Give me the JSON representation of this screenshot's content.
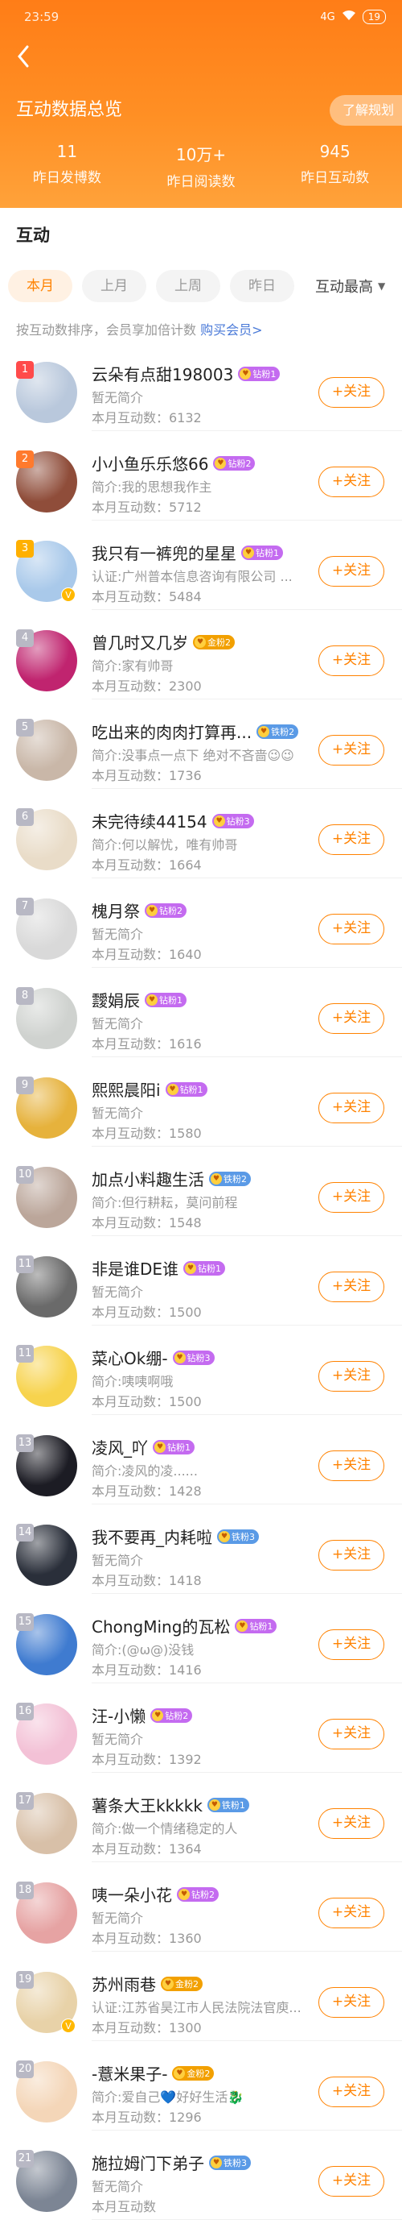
{
  "status_bar": {
    "time": "23:59",
    "signal": "4G",
    "battery": "19"
  },
  "header": {
    "title": "互动数据总览",
    "plan_button": "了解规划",
    "stats": [
      {
        "value": "11",
        "label": "昨日发博数"
      },
      {
        "value": "10万+",
        "label": "昨日阅读数"
      },
      {
        "value": "945",
        "label": "昨日互动数"
      }
    ]
  },
  "section": {
    "title": "互动"
  },
  "filters": {
    "tabs": [
      "本月",
      "上月",
      "上周",
      "昨日"
    ],
    "active_index": 0,
    "sort": "互动最高"
  },
  "hint": {
    "text": "按互动数排序，会员享加倍计数 ",
    "link": "购买会员>"
  },
  "follow_label": "+关注",
  "colors": {
    "accent": "#ff8200",
    "header_top": "#ff7d17",
    "header_bottom": "#ffa23a"
  },
  "users": [
    {
      "rank": "1",
      "name": "云朵有点甜198003",
      "badge": "钻粉1",
      "badge_color": "#c46bf0",
      "bio": "暂无简介",
      "count": "本月互动数：6132",
      "avatar": "#b9c8dc"
    },
    {
      "rank": "2",
      "name": "小小鱼乐乐悠66",
      "badge": "钻粉2",
      "badge_color": "#c46bf0",
      "bio": "简介:我的思想我作主",
      "count": "本月互动数：5712",
      "avatar": "#8f4d3a"
    },
    {
      "rank": "3",
      "name": "我只有一裤兜的星星",
      "badge": "钻粉1",
      "badge_color": "#c46bf0",
      "bio": "认证:广州普本信息咨询有限公司 ...",
      "count": "本月互动数：5484",
      "avatar": "#a9c9ea",
      "verified": true
    },
    {
      "rank": "4",
      "name": "曾几时又几岁",
      "badge": "金粉2",
      "badge_color": "#f2a000",
      "bio": "简介:家有帅哥",
      "count": "本月互动数：2300",
      "avatar": "#c0246f"
    },
    {
      "rank": "5",
      "name": "吃出来的肉肉打算再...",
      "badge": "铁粉2",
      "badge_color": "#5a9ae6",
      "bio": "简介:没事点一点下 绝对不吝啬😉😉",
      "count": "本月互动数：1736",
      "avatar": "#c9b7a8"
    },
    {
      "rank": "6",
      "name": "未完待续44154",
      "badge": "钻粉3",
      "badge_color": "#c46bf0",
      "bio": "简介:何以解忧，唯有帅哥",
      "count": "本月互动数：1664",
      "avatar": "#e9dcc8"
    },
    {
      "rank": "7",
      "name": "槐月祭",
      "badge": "钻粉2",
      "badge_color": "#c46bf0",
      "bio": "暂无简介",
      "count": "本月互动数：1640",
      "avatar": "#d9d9d9"
    },
    {
      "rank": "8",
      "name": "靉娟辰",
      "badge": "钻粉1",
      "badge_color": "#c46bf0",
      "bio": "暂无简介",
      "count": "本月互动数：1616",
      "avatar": "#cfd2cf"
    },
    {
      "rank": "9",
      "name": "熙熙晨阳i",
      "badge": "钻粉1",
      "badge_color": "#c46bf0",
      "bio": "暂无简介",
      "count": "本月互动数：1580",
      "avatar": "#e6b23c"
    },
    {
      "rank": "10",
      "name": "加点小料趣生活",
      "badge": "铁粉2",
      "badge_color": "#5a9ae6",
      "bio": "简介:但行耕耘，莫问前程",
      "count": "本月互动数：1548",
      "avatar": "#bba69a"
    },
    {
      "rank": "11",
      "name": "非是谁DE谁",
      "badge": "钻粉1",
      "badge_color": "#c46bf0",
      "bio": "暂无简介",
      "count": "本月互动数：1500",
      "avatar": "#6a6a6a"
    },
    {
      "rank": "11",
      "name": "菜心Ok绷-",
      "badge": "钻粉3",
      "badge_color": "#c46bf0",
      "bio": "简介:咦咦啊哦",
      "count": "本月互动数：1500",
      "avatar": "#f7d34d"
    },
    {
      "rank": "13",
      "name": "凌风_吖",
      "badge": "钻粉1",
      "badge_color": "#c46bf0",
      "bio": "简介:凌风的凌......",
      "count": "本月互动数：1428",
      "avatar": "#1c1c24"
    },
    {
      "rank": "14",
      "name": "我不要再_内耗啦",
      "badge": "铁粉3",
      "badge_color": "#5a9ae6",
      "bio": "暂无简介",
      "count": "本月互动数：1418",
      "avatar": "#2a2f3a"
    },
    {
      "rank": "15",
      "name": "ChongMing的瓦松",
      "badge": "钻粉1",
      "badge_color": "#c46bf0",
      "bio": "简介:(@ω@)没钱",
      "count": "本月互动数：1416",
      "avatar": "#3f7bd0"
    },
    {
      "rank": "16",
      "name": "汪-小懒",
      "badge": "钻粉2",
      "badge_color": "#c46bf0",
      "bio": "暂无简介",
      "count": "本月互动数：1392",
      "avatar": "#f3c1d6"
    },
    {
      "rank": "17",
      "name": "薯条大王kkkkk",
      "badge": "铁粉1",
      "badge_color": "#5a9ae6",
      "bio": "简介:做一个情绪稳定的人",
      "count": "本月互动数：1364",
      "avatar": "#d8c0a8"
    },
    {
      "rank": "18",
      "name": "咦一朵小花",
      "badge": "钻粉2",
      "badge_color": "#c46bf0",
      "bio": "暂无简介",
      "count": "本月互动数：1360",
      "avatar": "#e6a3a3"
    },
    {
      "rank": "19",
      "name": "苏州雨巷",
      "badge": "金粉2",
      "badge_color": "#f2a000",
      "bio": "认证:江苏省昊江市人民法院法官庾...",
      "count": "本月互动数：1300",
      "avatar": "#e8d2a8",
      "verified": true
    },
    {
      "rank": "20",
      "name": "-薏米果子-",
      "badge": "金粉2",
      "badge_color": "#f2a000",
      "bio": "简介:爱自己💙好好生活🐉",
      "count": "本月互动数：1296",
      "avatar": "#f4d6b8"
    },
    {
      "rank": "21",
      "name": "施拉姆门下弟子",
      "badge": "铁粉3",
      "badge_color": "#5a9ae6",
      "bio": "暂无简介",
      "count": "本月互动数",
      "avatar": "#7c8594"
    }
  ]
}
